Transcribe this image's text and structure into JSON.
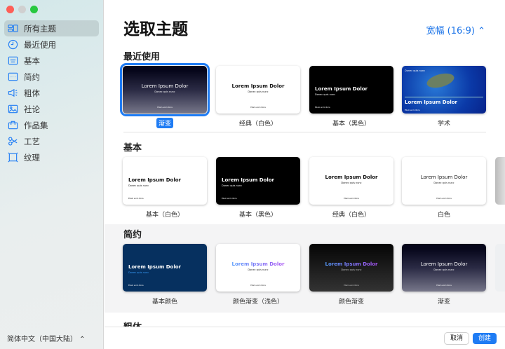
{
  "sidebar": {
    "items": [
      {
        "label": "所有主题",
        "icon": "all-themes-icon",
        "active": true
      },
      {
        "label": "最近使用",
        "icon": "clock-icon"
      },
      {
        "label": "基本",
        "icon": "basic-icon"
      },
      {
        "label": "简约",
        "icon": "ellipsis-box-icon"
      },
      {
        "label": "粗体",
        "icon": "megaphone-icon"
      },
      {
        "label": "社论",
        "icon": "photo-icon"
      },
      {
        "label": "作品集",
        "icon": "briefcase-icon"
      },
      {
        "label": "工艺",
        "icon": "scissors-icon"
      },
      {
        "label": "纹理",
        "icon": "texture-frame-icon"
      }
    ],
    "language": "简体中文（中国大陆） ⌃"
  },
  "header": {
    "title": "选取主题",
    "ratio": "宽幅 (16:9) ⌃"
  },
  "sections": [
    {
      "title": "最近使用",
      "themes": [
        {
          "label": "渐变",
          "style": "gradient",
          "selected": true
        },
        {
          "label": "经典（白色）",
          "style": "classic"
        },
        {
          "label": "基本（黑色）",
          "style": "black"
        },
        {
          "label": "学术",
          "style": "academic"
        }
      ]
    },
    {
      "title": "基本",
      "themes": [
        {
          "label": "基本（白色）",
          "style": "white"
        },
        {
          "label": "基本（黑色）",
          "style": "black"
        },
        {
          "label": "经典（白色）",
          "style": "classic"
        },
        {
          "label": "白色",
          "style": "plainwhite"
        }
      ]
    },
    {
      "title": "简约",
      "themes": [
        {
          "label": "基本颜色",
          "style": "navy"
        },
        {
          "label": "颜色渐变（浅色）",
          "style": "colorlight"
        },
        {
          "label": "颜色渐变",
          "style": "colordark"
        },
        {
          "label": "渐变",
          "style": "gradient"
        }
      ]
    },
    {
      "title": "粗体",
      "themes": []
    }
  ],
  "thumb_text": {
    "title": "Lorem Ipsum Dolor",
    "subtitle": "Donec quis nunc",
    "footer": "Etiam enim litora"
  },
  "footer": {
    "cancel": "取消",
    "create": "创建"
  },
  "colors": {
    "accent": "#1f7cf4",
    "close": "#fe5f57",
    "minimize": "#d0d0d0",
    "zoom": "#28c840"
  }
}
